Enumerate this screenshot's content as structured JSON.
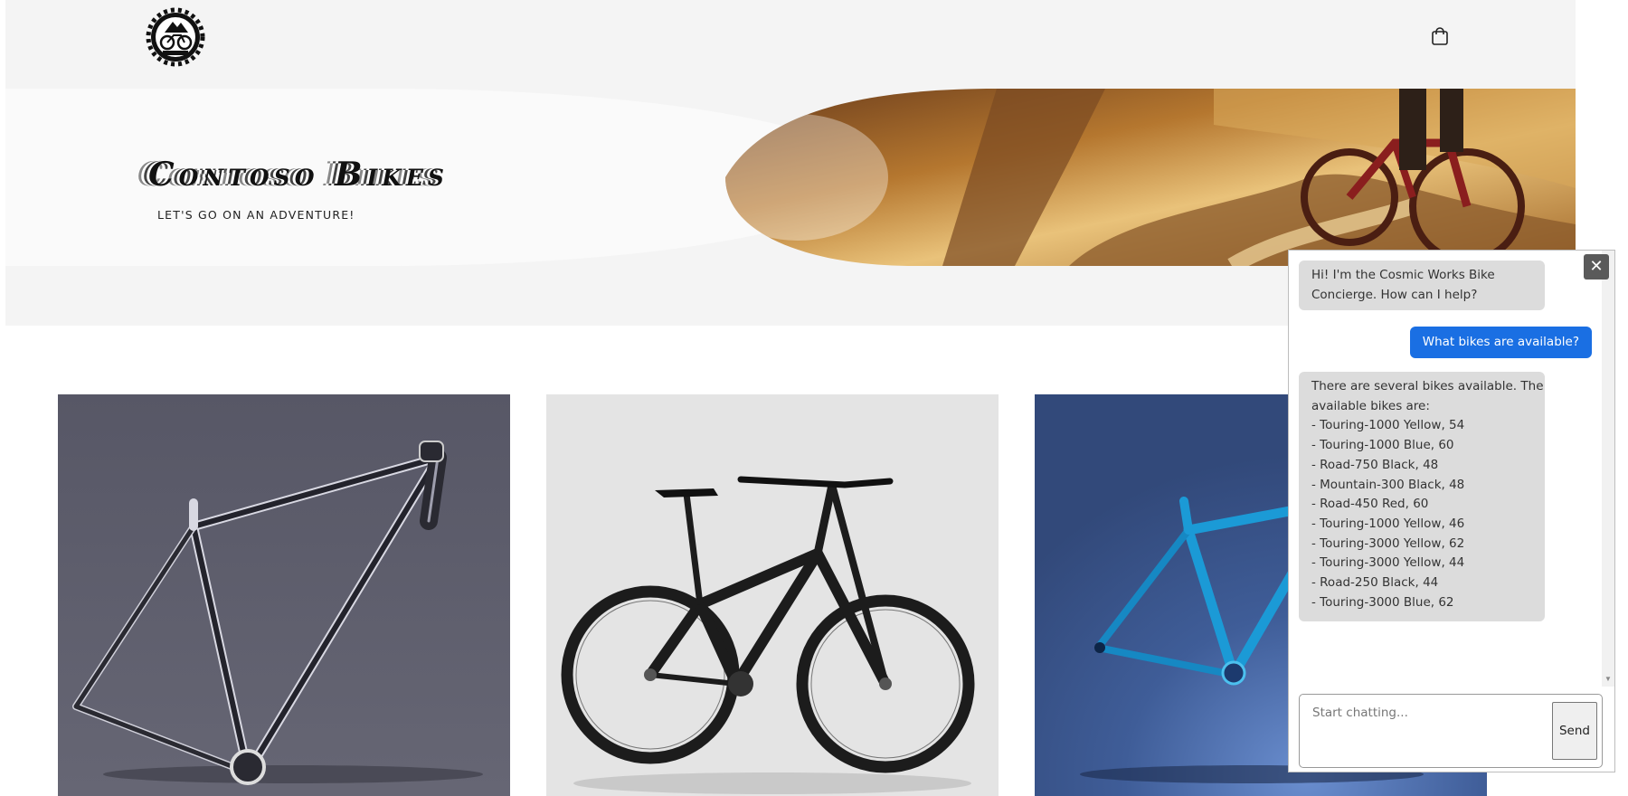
{
  "header": {
    "logo_icon": "bike-gear-logo-icon",
    "cart_icon": "shopping-bag-icon"
  },
  "hero": {
    "title": "Contoso Bikes",
    "tagline": "LET'S GO ON AN ADVENTURE!",
    "image": "mountain-bike-trail-photo"
  },
  "products": [
    {
      "image": "dark-bike-frame-photo"
    },
    {
      "image": "black-mountain-bike-photo"
    },
    {
      "image": "blue-bike-frame-photo"
    }
  ],
  "chat": {
    "close_label": "✕",
    "messages": [
      {
        "role": "bot",
        "lines": [
          "Hi! I'm the Cosmic Works Bike",
          "Concierge. How can I help?"
        ]
      },
      {
        "role": "user",
        "lines": [
          "What bikes are available?"
        ]
      },
      {
        "role": "bot",
        "lines": [
          "There are several bikes available. The",
          "available bikes are:",
          "- Touring-1000 Yellow, 54",
          "- Touring-1000 Blue, 60",
          "- Road-750 Black, 48",
          "- Mountain-300 Black, 48",
          "- Road-450 Red, 60",
          "- Touring-1000 Yellow, 46",
          "- Touring-3000 Yellow, 62",
          "- Touring-3000 Yellow, 44",
          "- Road-250 Black, 44",
          "- Touring-3000 Blue, 62"
        ]
      }
    ],
    "input_placeholder": "Start chatting...",
    "send_label": "Send",
    "colors": {
      "user_bubble": "#1a6fe3",
      "bot_bubble": "#dcdcdc"
    }
  }
}
